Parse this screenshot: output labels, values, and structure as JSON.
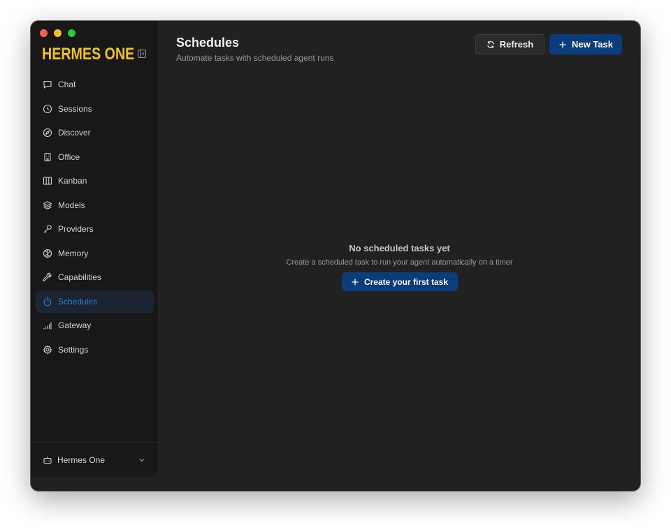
{
  "window": {
    "traffic_lights": [
      "close",
      "minimize",
      "zoom"
    ]
  },
  "app": {
    "logo": "HERMES ONE",
    "brand_color": "#f6c21c",
    "accent_color": "#2f7fd6"
  },
  "sidebar": {
    "items": [
      {
        "label": "Chat",
        "icon": "chat-icon"
      },
      {
        "label": "Sessions",
        "icon": "clock-icon"
      },
      {
        "label": "Discover",
        "icon": "compass-icon"
      },
      {
        "label": "Office",
        "icon": "building-icon"
      },
      {
        "label": "Kanban",
        "icon": "columns-icon"
      },
      {
        "label": "Models",
        "icon": "layers-icon"
      },
      {
        "label": "Providers",
        "icon": "key-icon"
      },
      {
        "label": "Memory",
        "icon": "brain-icon"
      },
      {
        "label": "Capabilities",
        "icon": "wrench-icon"
      },
      {
        "label": "Schedules",
        "icon": "timer-icon",
        "active": true
      },
      {
        "label": "Gateway",
        "icon": "signal-icon"
      },
      {
        "label": "Settings",
        "icon": "gear-icon"
      }
    ],
    "profile": {
      "label": "Hermes One",
      "icon": "bot-icon"
    }
  },
  "header": {
    "title": "Schedules",
    "subtitle": "Automate tasks with scheduled agent runs",
    "refresh_label": "Refresh",
    "new_task_label": "New Task"
  },
  "empty_state": {
    "title": "No scheduled tasks yet",
    "description": "Create a scheduled task to run your agent automatically on a timer",
    "button_label": "Create your first task"
  }
}
